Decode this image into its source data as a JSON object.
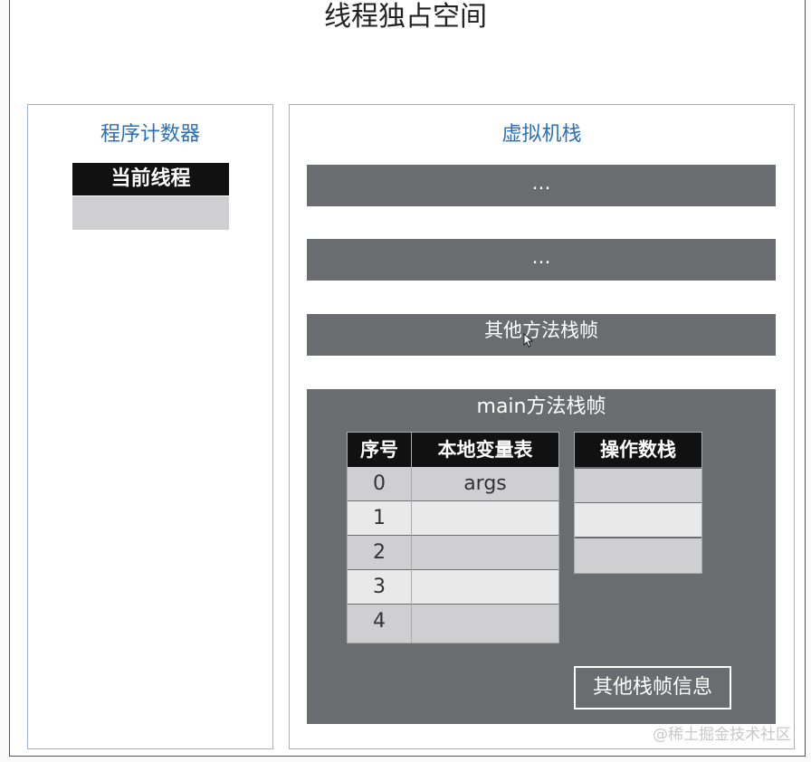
{
  "title": "线程独占空间",
  "program_counter": {
    "title": "程序计数器",
    "header": "当前线程"
  },
  "vm_stack": {
    "title": "虚拟机栈",
    "frames": [
      "…",
      "…",
      "其他方法栈帧"
    ],
    "main_frame": {
      "title": "main方法栈帧",
      "local_vars": {
        "headers": [
          "序号",
          "本地变量表"
        ],
        "rows": [
          {
            "index": "0",
            "value": "args"
          },
          {
            "index": "1",
            "value": ""
          },
          {
            "index": "2",
            "value": ""
          },
          {
            "index": "3",
            "value": ""
          },
          {
            "index": "4",
            "value": ""
          }
        ]
      },
      "operand_stack": {
        "header": "操作数栈"
      },
      "other_info": "其他栈帧信息"
    }
  },
  "watermark": "@稀土掘金技术社区",
  "colors": {
    "frame_bg": "#6b6c70",
    "header_bg": "#111111",
    "panel_border": "#9ab3d3",
    "panel_title": "#2d6fb8"
  }
}
